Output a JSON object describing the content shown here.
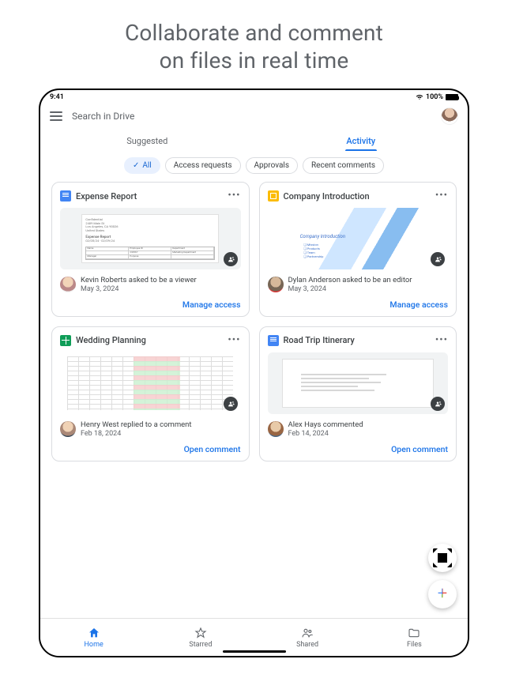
{
  "headline_line1": "Collaborate and comment",
  "headline_line2": "on files in real time",
  "status": {
    "time": "9:41",
    "battery": "100%"
  },
  "search": {
    "placeholder": "Search in Drive"
  },
  "tabs": {
    "suggested": "Suggested",
    "activity": "Activity"
  },
  "chips": {
    "all": "All",
    "access": "Access requests",
    "approvals": "Approvals",
    "recent": "Recent comments"
  },
  "cards": [
    {
      "title": "Expense Report",
      "activity": "Kevin Roberts asked to be a viewer",
      "date": "May 3, 2024",
      "action": "Manage access"
    },
    {
      "title": "Company Introduction",
      "slide_title": "Company Introduction",
      "bullets": [
        "Mission",
        "Products",
        "Team",
        "Partnership"
      ],
      "activity": "Dylan Anderson asked to be an editor",
      "date": "May 3, 2024",
      "action": "Manage access"
    },
    {
      "title": "Wedding Planning",
      "activity": "Henry West replied to a comment",
      "date": "Feb 18, 2024",
      "action": "Open comment"
    },
    {
      "title": "Road Trip Itinerary",
      "activity": "Alex Hays commented",
      "date": "Feb 14, 2024",
      "action": "Open comment"
    }
  ],
  "nav": {
    "home": "Home",
    "starred": "Starred",
    "shared": "Shared",
    "files": "Files"
  }
}
